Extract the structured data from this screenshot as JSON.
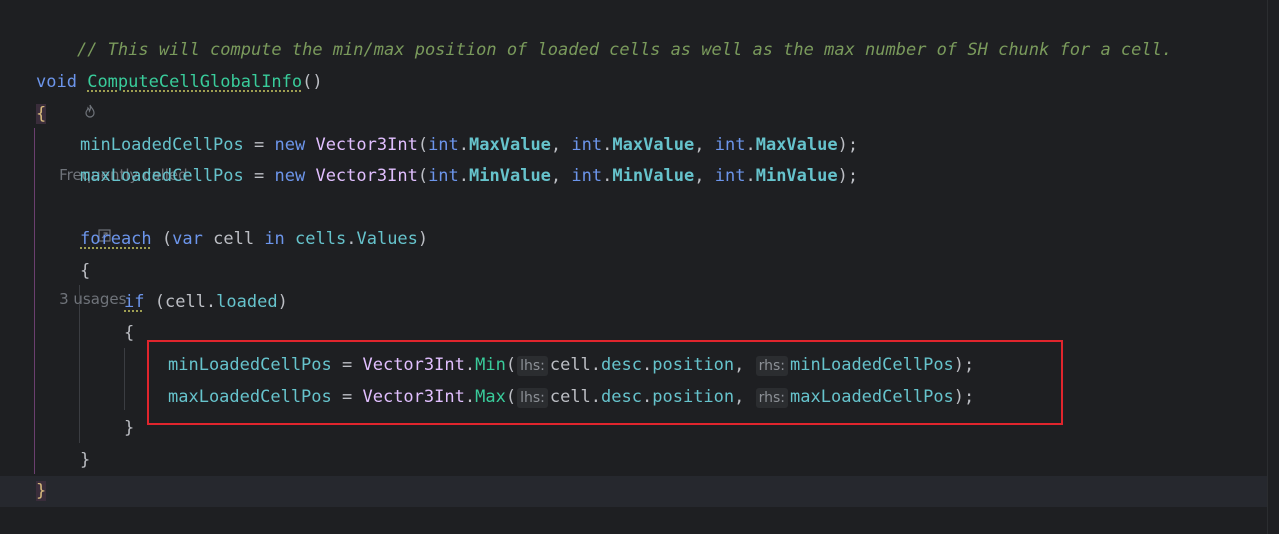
{
  "editor": {
    "comment": "// This will compute the min/max position of loaded cells as well as the max number of SH chunk for a cell.",
    "hints": {
      "frequently_called": "Frequently called",
      "usages": "3 usages"
    },
    "signature": {
      "return_type": "void",
      "method_name": "ComputeCellGlobalInfo",
      "parens": "()"
    },
    "open_brace": "{",
    "close_brace": "}",
    "min_var": "minLoadedCellPos",
    "max_var": "maxLoadedCellPos",
    "kw_new": "new",
    "type_vector": "Vector3Int",
    "kw_int": "int",
    "max_value": "MaxValue",
    "min_value": "MinValue",
    "kw_foreach": "foreach",
    "kw_var": "var",
    "var_cell": "cell",
    "kw_in": "in",
    "field_cells": "cells",
    "field_values": "Values",
    "kw_if": "if",
    "field_loaded": "loaded",
    "method_min": "Min",
    "method_max": "Max",
    "hint_lhs": "lhs:",
    "hint_rhs": "rhs:",
    "field_desc": "desc",
    "field_position": "position",
    "colors": {
      "keyword": "#6c95eb",
      "method": "#39cc9b",
      "field": "#66c3cc",
      "comment": "#7a9a5c",
      "highlight_box": "#e0252d"
    },
    "icons": {
      "frequently_called": "flame-icon",
      "usages": "usages-arrow-icon"
    }
  }
}
